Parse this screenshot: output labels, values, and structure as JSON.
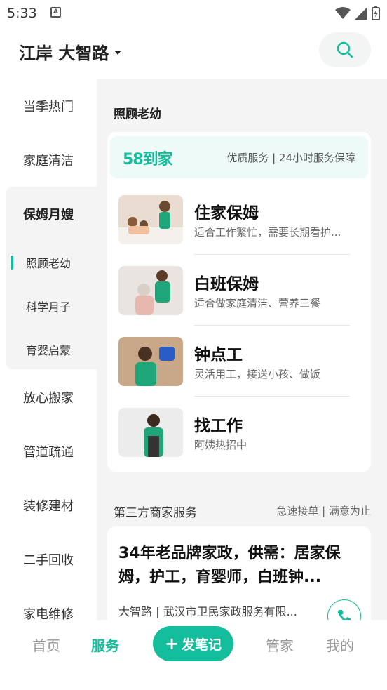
{
  "status_bar": {
    "time": "5:33",
    "notif_glyph": "A"
  },
  "header": {
    "location": "江岸 大智路"
  },
  "sidebar": {
    "items_top": [
      {
        "label": "当季热门"
      },
      {
        "label": "家庭清洁"
      }
    ],
    "group": {
      "title": "保姆月嫂",
      "subs": [
        {
          "label": "照顾老幼",
          "active": true
        },
        {
          "label": "科学月子"
        },
        {
          "label": "育婴启蒙"
        }
      ]
    },
    "items_bottom": [
      {
        "label": "放心搬家"
      },
      {
        "label": "管道疏通"
      },
      {
        "label": "装修建材"
      },
      {
        "label": "二手回收"
      },
      {
        "label": "家电维修"
      }
    ]
  },
  "main": {
    "section_title": "照顾老幼",
    "brand": {
      "logo": "58到家",
      "slogan": "优质服务 | 24小时服务保障"
    },
    "services": [
      {
        "title": "住家保姆",
        "desc": "适合工作繁忙，需要长期看护..."
      },
      {
        "title": "白班保姆",
        "desc": "适合做家庭清洁、营养三餐"
      },
      {
        "title": "钟点工",
        "desc": "灵活用工，接送小孩、做饭"
      },
      {
        "title": "找工作",
        "desc": "阿姨热招中"
      }
    ],
    "third_party": {
      "title": "第三方商家服务",
      "subtitle": "急速接单 | 满意为止",
      "listing": {
        "title": "34年老品牌家政，供需：居家保姆，护工，育婴师，白班钟...",
        "meta": "大智路 | 武汉市卫民家政服务有限..."
      }
    }
  },
  "bottom_nav": {
    "home": "首页",
    "service": "服务",
    "post": "发笔记",
    "butler": "管家",
    "mine": "我的"
  },
  "colors": {
    "accent": "#14bd9b",
    "panel_bg": "#f4f4f4"
  }
}
